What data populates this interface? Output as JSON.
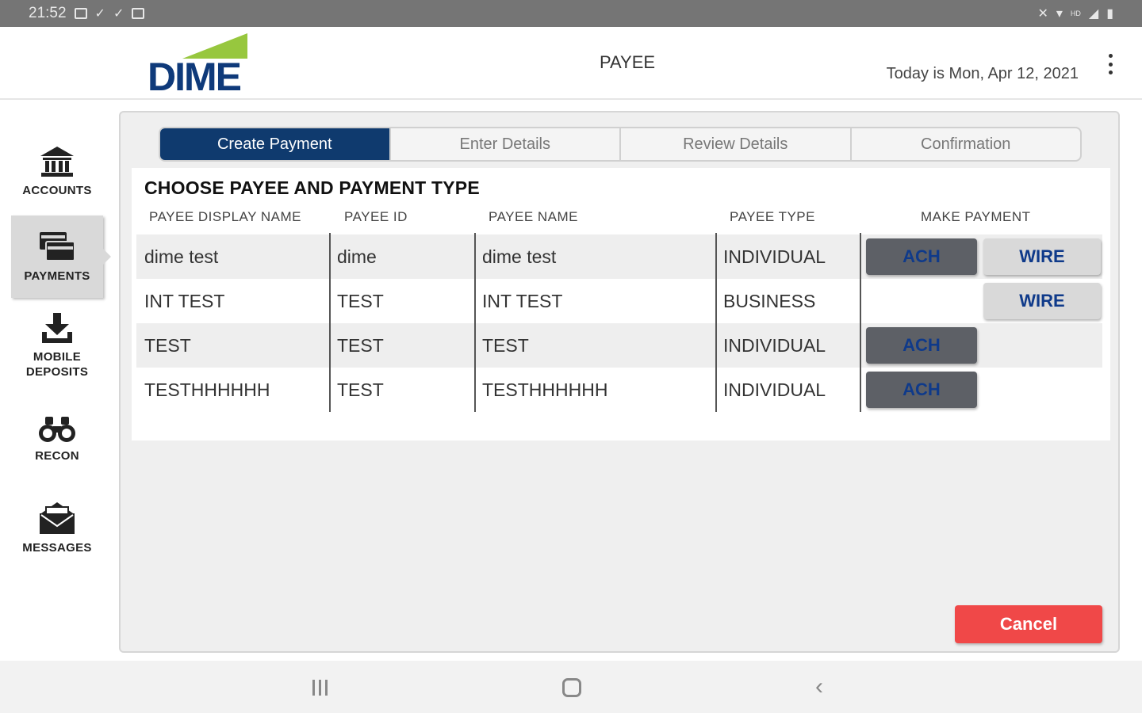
{
  "status_bar": {
    "time": "21:52",
    "signal_text": "HD"
  },
  "header": {
    "logo_text": "DIME",
    "title": "PAYEE",
    "today": "Today is Mon, Apr 12, 2021"
  },
  "sidebar": {
    "items": [
      {
        "label": "ACCOUNTS",
        "icon": "bank-icon",
        "active": false
      },
      {
        "label": "PAYMENTS",
        "icon": "payments-icon",
        "active": true
      },
      {
        "label": "MOBILE DEPOSITS",
        "line1": "MOBILE",
        "line2": "DEPOSITS",
        "icon": "download-icon",
        "active": false
      },
      {
        "label": "RECON",
        "icon": "binoculars-icon",
        "active": false
      },
      {
        "label": "MESSAGES",
        "icon": "envelope-icon",
        "active": false
      }
    ]
  },
  "stepper": {
    "steps": [
      "Create Payment",
      "Enter Details",
      "Review Details",
      "Confirmation"
    ],
    "active": 0
  },
  "table": {
    "title": "CHOOSE PAYEE AND PAYMENT TYPE",
    "headers": [
      "PAYEE DISPLAY NAME",
      "PAYEE ID",
      "PAYEE NAME",
      "PAYEE TYPE",
      "MAKE PAYMENT"
    ],
    "rows": [
      {
        "display_name": "dime test",
        "payee_id": "dime",
        "payee_name": "dime test",
        "payee_type": "INDIVIDUAL",
        "ach": "ACH",
        "wire": "WIRE"
      },
      {
        "display_name": "INT TEST",
        "payee_id": "TEST",
        "payee_name": "INT TEST",
        "payee_type": "BUSINESS",
        "ach": null,
        "wire": "WIRE"
      },
      {
        "display_name": "TEST",
        "payee_id": "TEST",
        "payee_name": "TEST",
        "payee_type": "INDIVIDUAL",
        "ach": "ACH",
        "wire": null
      },
      {
        "display_name": "TESTHHHHHH",
        "payee_id": "TEST",
        "payee_name": "TESTHHHHHH",
        "payee_type": "INDIVIDUAL",
        "ach": "ACH",
        "wire": null
      }
    ]
  },
  "actions": {
    "cancel_label": "Cancel"
  },
  "colors": {
    "brand_navy": "#0f3a6e",
    "brand_green": "#97c73e",
    "cancel_red": "#f04848",
    "ach_button": "#5d6066",
    "wire_button": "#d9d9d9"
  }
}
